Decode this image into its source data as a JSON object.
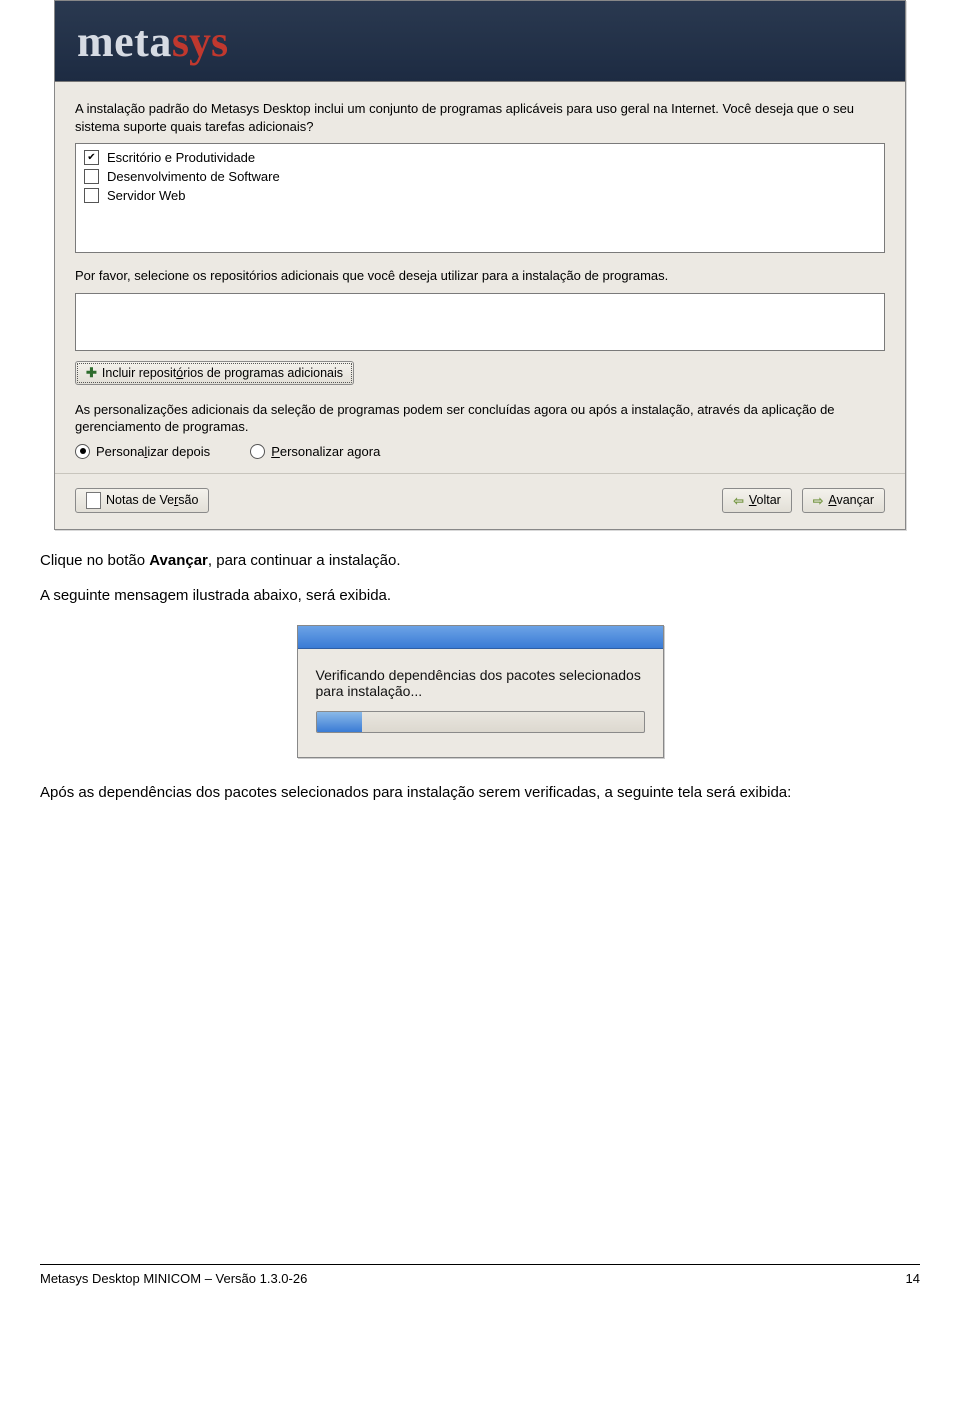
{
  "installer": {
    "logo": {
      "meta": "meta",
      "sys": "sys"
    },
    "intro": "A instalação padrão do Metasys Desktop inclui um conjunto de programas aplicáveis para uso geral na Internet. Você deseja que o seu sistema suporte quais tarefas adicionais?",
    "tasks": [
      {
        "label": "Escritório e Produtividade",
        "checked": true
      },
      {
        "label": "Desenvolvimento de Software",
        "checked": false
      },
      {
        "label": "Servidor Web",
        "checked": false
      }
    ],
    "repo_text": "Por favor, selecione os repositórios adicionais que você deseja utilizar para a instalação de programas.",
    "add_repo_pre": "Incluir reposit",
    "add_repo_u": "ó",
    "add_repo_post": "rios de programas adicionais",
    "customize_text": "As personalizações adicionais da seleção de programas podem ser concluídas agora ou após a instalação, através da aplicação de gerenciamento de programas.",
    "radios": {
      "later_pre": "Persona",
      "later_u": "l",
      "later_post": "izar depois",
      "now_u": "P",
      "now_post": "ersonalizar agora"
    },
    "notes_pre": "Notas de Ve",
    "notes_u": "r",
    "notes_post": "são",
    "back_u": "V",
    "back_post": "oltar",
    "next_u": "A",
    "next_post": "vançar"
  },
  "doc": {
    "line1a": "Clique no botão ",
    "line1b": "Avançar",
    "line1c": ", para continuar a instalação.",
    "line2": "A seguinte mensagem ilustrada abaixo, será exibida.",
    "line3": "Após as dependências dos pacotes selecionados para instalação serem verificadas, a seguinte tela será exibida:"
  },
  "progress": {
    "text": "Verificando dependências dos pacotes selecionados para instalação..."
  },
  "footer": {
    "left": "Metasys Desktop MINICOM – Versão 1.3.0-26",
    "right": "14"
  }
}
